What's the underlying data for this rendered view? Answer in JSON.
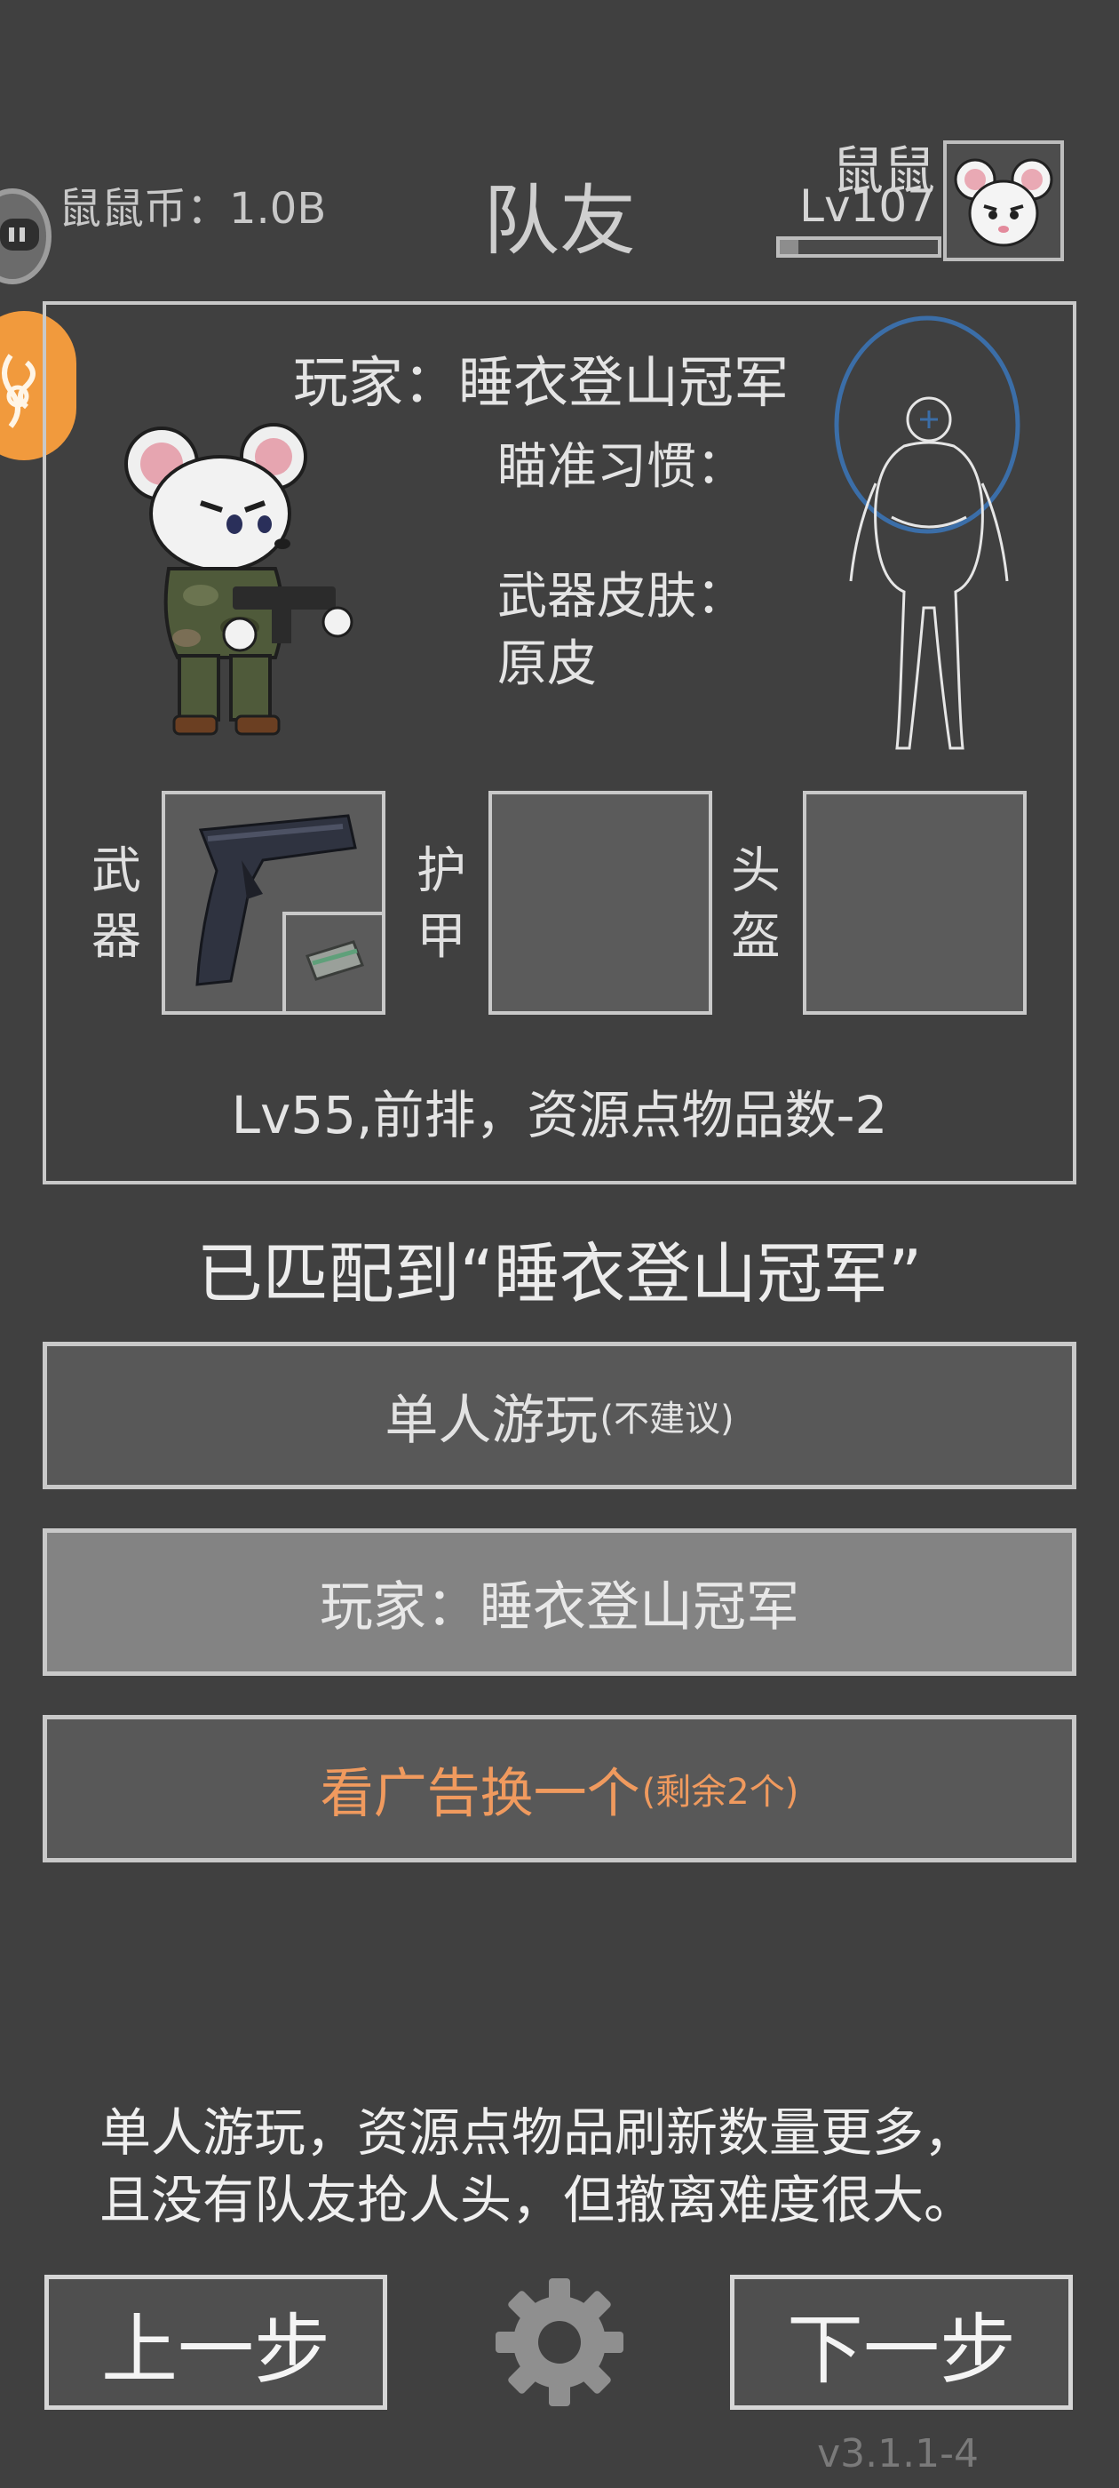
{
  "header": {
    "coins": "鼠鼠币：1.0B",
    "title": "队友",
    "user_name": "鼠鼠",
    "user_level": "Lv107",
    "xp_progress": 0.12
  },
  "teammate": {
    "player_line": "玩家：睡衣登山冠军",
    "aim_label": "瞄准习惯：",
    "skin_label": "武器皮肤：",
    "skin_value": "原皮",
    "slots": {
      "weapon_label": "武器",
      "armor_label": "护甲",
      "helmet_label": "头盔"
    },
    "stats": "Lv55,前排，资源点物品数-2"
  },
  "matched_text": "已匹配到“睡衣登山冠军”",
  "buttons": {
    "solo_main": "单人游玩",
    "solo_note": "(不建议)",
    "player_option": "玩家：睡衣登山冠军",
    "ad_main": "看广告换一个",
    "ad_note": "(剩余2个)"
  },
  "description": {
    "line1": "单人游玩，资源点物品刷新数量更多，",
    "line2": "且没有队友抢人头，但撤离难度很大。"
  },
  "nav": {
    "prev": "上一步",
    "next": "下一步"
  },
  "version": "v3.1.1-4",
  "colors": {
    "background": "#404040",
    "accent_orange": "#f09a5e",
    "side_button_orange": "#f19a3d",
    "target_ring_blue": "#3b6ea8"
  },
  "icons": {
    "side_button_1": "chat-bubble-icon",
    "side_button_2": "swirl-icon",
    "settings": "gear-icon"
  }
}
